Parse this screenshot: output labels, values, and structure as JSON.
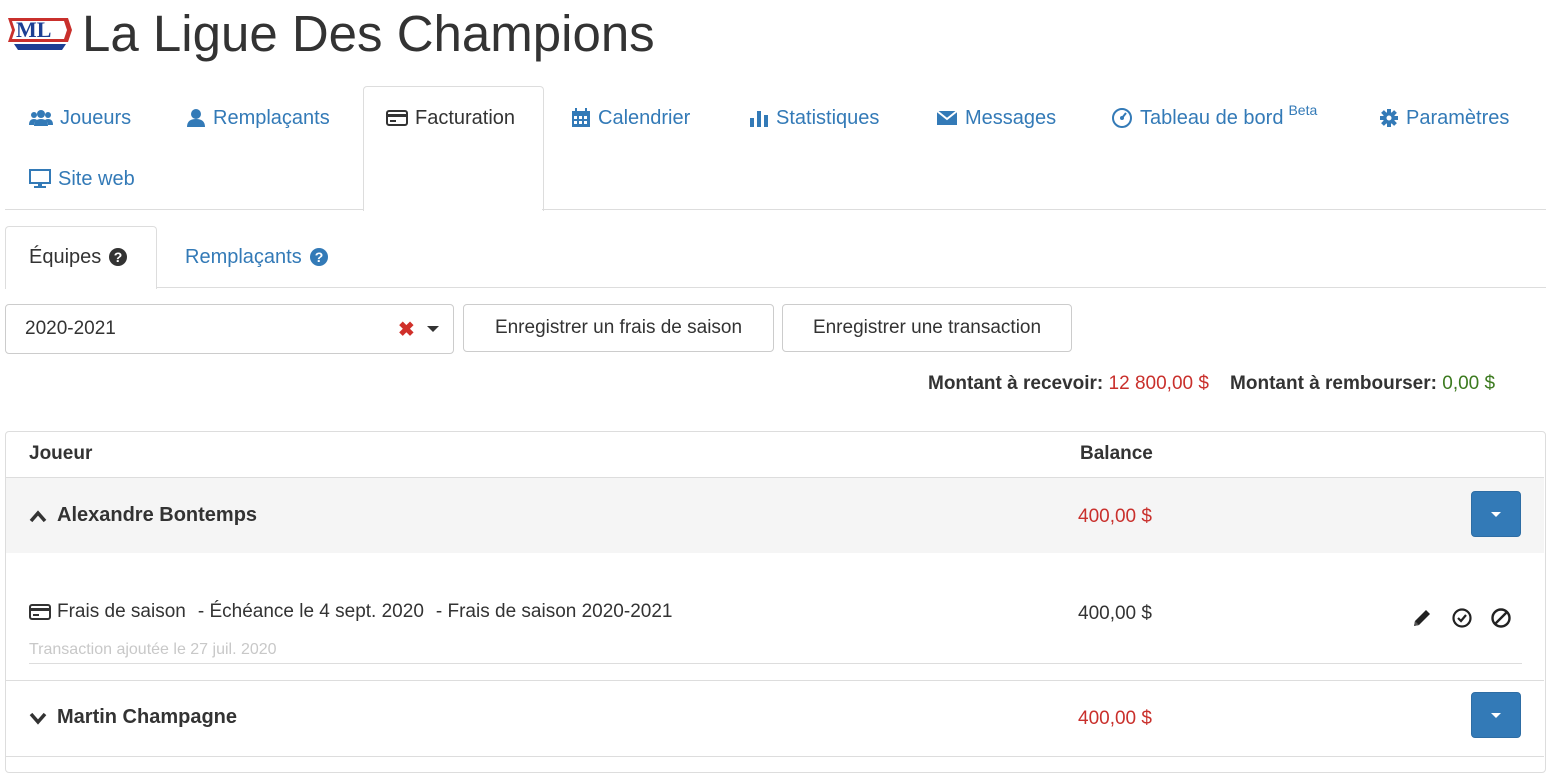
{
  "app": {
    "logo_text": "ML",
    "title": "La Ligue Des Champions",
    "colors": {
      "link": "#337ab7",
      "owed": "#c9302c",
      "refund": "#3c7a1f",
      "primary_button": "#337ab7"
    }
  },
  "nav": {
    "items": [
      {
        "label": "Joueurs",
        "icon": "users-icon"
      },
      {
        "label": "Remplaçants",
        "icon": "user-icon"
      },
      {
        "label": "Facturation",
        "icon": "credit-card-icon",
        "active": true
      },
      {
        "label": "Calendrier",
        "icon": "calendar-icon"
      },
      {
        "label": "Statistiques",
        "icon": "bar-chart-icon"
      },
      {
        "label": "Messages",
        "icon": "envelope-icon"
      },
      {
        "label": "Tableau de bord",
        "icon": "dashboard-icon",
        "badge": "Beta"
      },
      {
        "label": "Paramètres",
        "icon": "gear-icon"
      },
      {
        "label": "Site web",
        "icon": "monitor-icon"
      }
    ]
  },
  "subtabs": {
    "items": [
      {
        "label": "Équipes",
        "icon": "help-icon",
        "active": true
      },
      {
        "label": "Remplaçants",
        "icon": "help-icon"
      }
    ]
  },
  "toolbar": {
    "season_select": "2020-2021",
    "clear_symbol": "✖",
    "season_fee_button": "Enregistrer un frais de saison",
    "transaction_button": "Enregistrer une transaction"
  },
  "totals": {
    "receivable_label": "Montant à recevoir:",
    "receivable_value": "12 800,00 $",
    "refund_label": "Montant à rembourser:",
    "refund_value": "0,00 $"
  },
  "table": {
    "headers": {
      "player": "Joueur",
      "balance": "Balance"
    },
    "rows": [
      {
        "player": "Alexandre Bontemps",
        "balance": "400,00 $",
        "expanded": true,
        "transactions": [
          {
            "type": "Frais de saison",
            "due": "- Échéance le 4 sept. 2020",
            "description": "- Frais de saison 2020-2021",
            "amount": "400,00 $",
            "added": "Transaction ajoutée le 27 juil. 2020"
          }
        ]
      },
      {
        "player": "Martin Champagne",
        "balance": "400,00 $",
        "expanded": false
      }
    ]
  }
}
